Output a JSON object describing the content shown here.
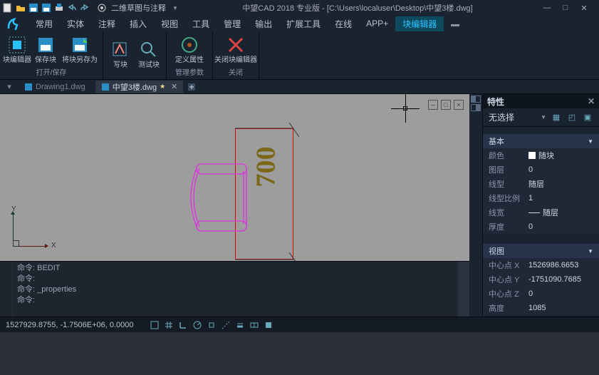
{
  "title_bar": {
    "workspace": "二维草图与注释",
    "app_title": "中望CAD 2018 专业版 - [C:\\Users\\localuser\\Desktop\\中望3楼.dwg]"
  },
  "menu": {
    "items": [
      "常用",
      "实体",
      "注释",
      "插入",
      "视图",
      "工具",
      "管理",
      "输出",
      "扩展工具",
      "在线",
      "APP+",
      "块编辑器"
    ],
    "active_index": 11
  },
  "ribbon": {
    "groups": [
      {
        "title": "打开/保存",
        "buttons": [
          {
            "label": "块编辑器"
          },
          {
            "label": "保存块"
          },
          {
            "label": "将块另存为"
          }
        ]
      },
      {
        "title": "",
        "buttons": [
          {
            "label": "写块"
          },
          {
            "label": "测试块"
          }
        ]
      },
      {
        "title": "管理参数",
        "buttons": [
          {
            "label": "定义属性"
          }
        ]
      },
      {
        "title": "关闭",
        "buttons": [
          {
            "label": "关闭块编辑器"
          }
        ]
      }
    ]
  },
  "tabs": {
    "items": [
      {
        "label": "Drawing1.dwg",
        "active": false
      },
      {
        "label": "中望3楼.dwg",
        "active": true,
        "starred": true
      }
    ]
  },
  "canvas": {
    "axis_x": "X",
    "axis_y": "Y",
    "dim_value": "700"
  },
  "cmdline": {
    "lines": [
      "命令:  BEDIT",
      "命令:",
      "命令:  _properties",
      "命令: "
    ]
  },
  "props": {
    "title": "特性",
    "selection": "无选择",
    "sections": [
      {
        "title": "基本",
        "rows": [
          {
            "k": "颜色",
            "v": "随块",
            "swatch": true
          },
          {
            "k": "图层",
            "v": "0"
          },
          {
            "k": "线型",
            "v": "随层"
          },
          {
            "k": "线型比例",
            "v": "1"
          },
          {
            "k": "线宽",
            "v": "随层",
            "line": true
          },
          {
            "k": "厚度",
            "v": "0"
          }
        ]
      },
      {
        "title": "视图",
        "rows": [
          {
            "k": "中心点 X",
            "v": "1526986.6653"
          },
          {
            "k": "中心点 Y",
            "v": "-1751090.7685"
          },
          {
            "k": "中心点 Z",
            "v": "0"
          },
          {
            "k": "高度",
            "v": "1085"
          }
        ]
      }
    ]
  },
  "status": {
    "coords": "1527929.8755, -1.7506E+06, 0.0000"
  }
}
